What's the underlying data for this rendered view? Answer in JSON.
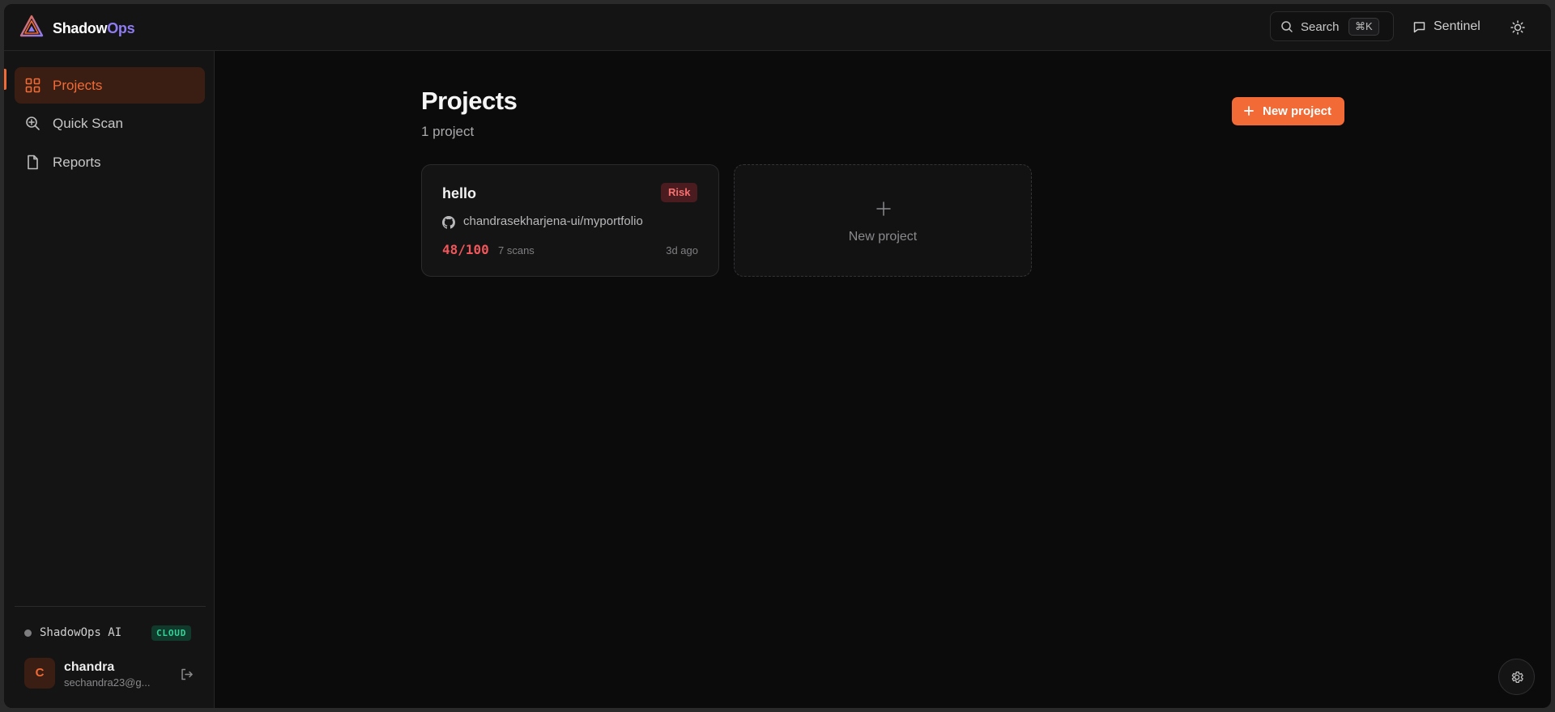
{
  "app": {
    "brand_primary": "Shadow",
    "brand_accent": "Ops",
    "accent_color": "#f26a35",
    "brand_accent_color": "#8f7bf2"
  },
  "header": {
    "search_label": "Search",
    "search_shortcut": "⌘K",
    "sentinel_label": "Sentinel"
  },
  "sidebar": {
    "items": [
      {
        "label": "Projects",
        "icon": "grid-icon",
        "active": true
      },
      {
        "label": "Quick Scan",
        "icon": "scan-search-icon",
        "active": false
      },
      {
        "label": "Reports",
        "icon": "document-icon",
        "active": false
      }
    ],
    "ai_label": "ShadowOps AI",
    "ai_badge": "CLOUD",
    "user": {
      "initial": "C",
      "name": "chandra",
      "email": "sechandra23@g..."
    }
  },
  "main": {
    "title": "Projects",
    "subtitle": "1 project",
    "new_button_label": "New project",
    "projects": [
      {
        "name": "hello",
        "badge": "Risk",
        "repo": "chandrasekharjena-ui/myportfolio",
        "score": "48/100",
        "scans": "7 scans",
        "updated": "3d ago"
      }
    ],
    "new_card_label": "New project"
  }
}
